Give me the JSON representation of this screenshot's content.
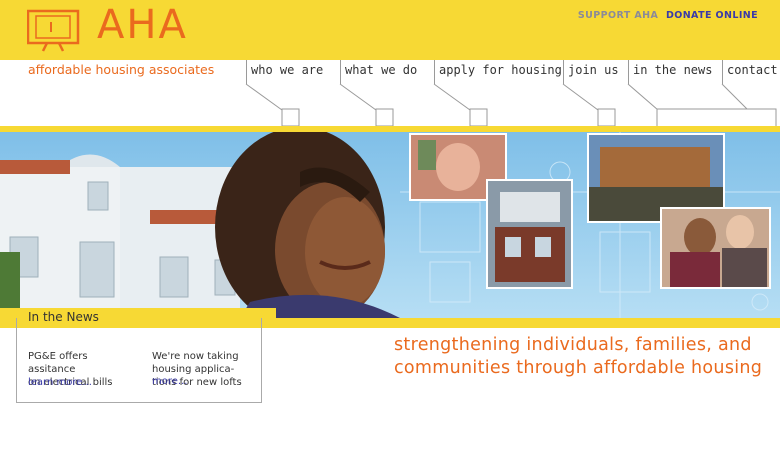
{
  "brand": {
    "logo_text": "AHA",
    "tagline": "affordable housing associates",
    "orange": "#ea6a1e",
    "yellow": "#f7d934"
  },
  "support": {
    "label": "SUPPORT AHA",
    "donate": "DONATE ONLINE"
  },
  "nav": {
    "items": [
      {
        "label": "who we are"
      },
      {
        "label": "what we do"
      },
      {
        "label": "apply for housing"
      },
      {
        "label": "join us"
      },
      {
        "label": "in the news"
      },
      {
        "label": "contact"
      }
    ]
  },
  "news": {
    "title": "In the News",
    "items": [
      {
        "text": "PG&E offers\nassitance\non electrical bills",
        "more": "learn more..."
      },
      {
        "text": "We're now taking\nhousing applica-\ntions for new lofts",
        "more": "more..."
      }
    ]
  },
  "headline": "strengthening individuals, families, and communities through affordable housing"
}
